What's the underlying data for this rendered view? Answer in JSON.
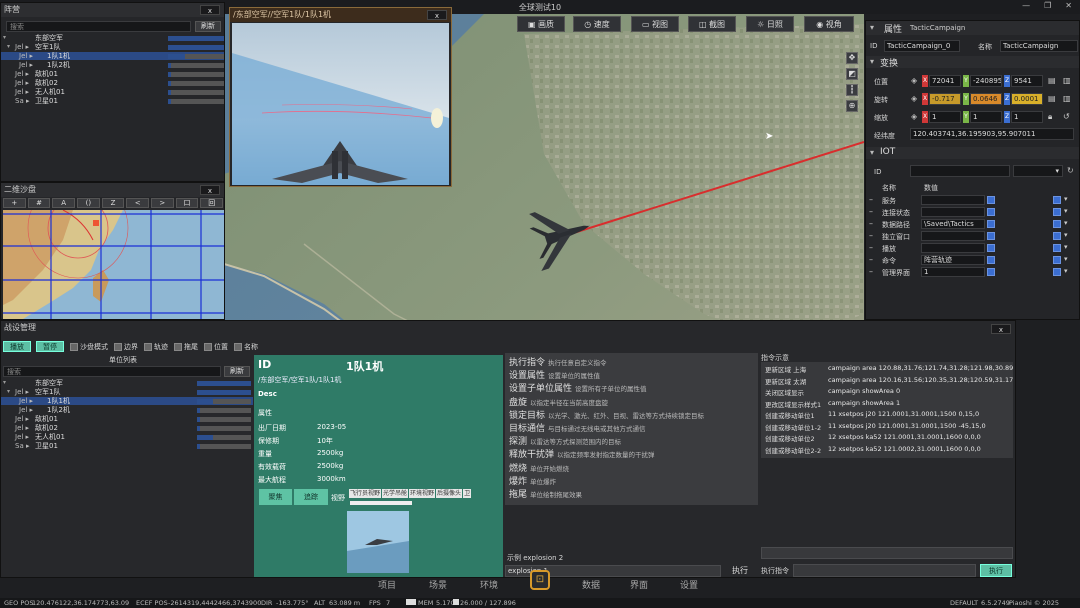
{
  "window": {
    "title": "全球测试10",
    "controls": [
      "—",
      "❐",
      "✕"
    ]
  },
  "toolbar": {
    "buttons": [
      "画质",
      "速度",
      "视图",
      "截图",
      "日照",
      "视角"
    ]
  },
  "formation": {
    "title": "阵营",
    "close": "x",
    "search_placeholder": "搜索",
    "refresh": "刷新",
    "rows": [
      {
        "prefix": "",
        "label": "东部空军",
        "level": 0
      },
      {
        "prefix": "Jel ▸",
        "label": "空军1队",
        "level": 1
      },
      {
        "prefix": "Jel ▸",
        "label": "1队1机",
        "level": 2,
        "selected": true
      },
      {
        "prefix": "Jel ▸",
        "label": "1队2机",
        "level": 2
      },
      {
        "prefix": "Jel ▸",
        "label": "敌机01",
        "level": 1
      },
      {
        "prefix": "Jel ▸",
        "label": "敌机02",
        "level": 1
      },
      {
        "prefix": "Jel ▸",
        "label": "无人机01",
        "level": 1
      },
      {
        "prefix": "Sa ▸",
        "label": "卫星01",
        "level": 1
      }
    ],
    "bar_levels": [
      1,
      1,
      0.3,
      0.05,
      0.05,
      0.05,
      0.05,
      0.05
    ]
  },
  "sandbox": {
    "title": "二维沙盘",
    "close": "x",
    "tools": [
      "+",
      "#",
      "A",
      "()",
      "Z",
      "<",
      ">",
      "口",
      "回"
    ]
  },
  "camera_view": {
    "title": "/东部空军//空军1队/1队1机",
    "close": "x"
  },
  "properties": {
    "title": "属性",
    "object_name": "TacticCampaign",
    "id_label": "ID",
    "id_value": "TacticCampaign_0",
    "name_label": "名称",
    "name_value": "TacticCampaign",
    "transform_header": "变换",
    "position_label": "位置",
    "position": [
      "72041",
      "-240895",
      "9541"
    ],
    "rotation_label": "旋转",
    "rotation": [
      "-0.717",
      "0.0646",
      "0.0001"
    ],
    "scale_label": "缩放",
    "scale": [
      "1",
      "1",
      "1"
    ],
    "lonlat_label": "经纬度",
    "lonlat_value": "120.403741,36.195903,95.907011",
    "iot_header": "IOT",
    "iot_id_label": "ID",
    "iot_col_name": "名称",
    "iot_col_value": "数值",
    "iot_rows": [
      {
        "name": "服务",
        "value": ""
      },
      {
        "name": "连接状态",
        "value": ""
      },
      {
        "name": "数据路径",
        "value": "\\Saved\\Tactics"
      },
      {
        "name": "独立窗口",
        "value": ""
      },
      {
        "name": "播放",
        "value": ""
      },
      {
        "name": "命令",
        "value": "阵营轨迹"
      },
      {
        "name": "管理界面",
        "value": "1"
      }
    ]
  },
  "campaign": {
    "title": "战设管理",
    "close": "x",
    "play": "播放",
    "pause": "暂停",
    "options": [
      "沙盘模式",
      "边界",
      "轨迹",
      "拖尾",
      "位置",
      "名称"
    ],
    "unit_list_title": "单位列表",
    "search_placeholder": "搜索",
    "refresh": "刷新",
    "rows": [
      {
        "prefix": "",
        "label": "东部空军",
        "level": 0
      },
      {
        "prefix": "Jel ▸",
        "label": "空军1队",
        "level": 1
      },
      {
        "prefix": "Jel ▸",
        "label": "1队1机",
        "level": 2,
        "selected": true
      },
      {
        "prefix": "Jel ▸",
        "label": "1队2机",
        "level": 2
      },
      {
        "prefix": "Jel ▸",
        "label": "敌机01",
        "level": 1
      },
      {
        "prefix": "Jel ▸",
        "label": "敌机02",
        "level": 1
      },
      {
        "prefix": "Jel ▸",
        "label": "无人机01",
        "level": 1
      },
      {
        "prefix": "Sa ▸",
        "label": "卫星01",
        "level": 1
      }
    ],
    "bar_levels": [
      1,
      1,
      0.3,
      0.05,
      0.05,
      0.05,
      0.3,
      0.05
    ]
  },
  "unit_detail": {
    "id_label": "ID",
    "id_value": "1队1机",
    "path": "/东部空军/空军1队/1队1机",
    "desc_label": "Desc",
    "attr_label": "属性",
    "fields": [
      {
        "k": "出厂日期",
        "v": "2023-05"
      },
      {
        "k": "保修期",
        "v": "10年"
      },
      {
        "k": "重量",
        "v": "2500kg"
      },
      {
        "k": "有效载荷",
        "v": "2500kg"
      },
      {
        "k": "最大航程",
        "v": "3000km"
      }
    ],
    "follow_btn": "聚焦",
    "track_btn": "追踪",
    "view_label": "视野",
    "view_tabs": [
      "飞行员视野",
      "光学吊舱",
      "环境视野",
      "后摄像头",
      "卫"
    ]
  },
  "commands": {
    "rows": [
      {
        "name": "执行指令",
        "desc": "执行任意自定义指令"
      },
      {
        "name": "设置属性",
        "desc": "设置单位的属性值"
      },
      {
        "name": "设置子单位属性",
        "desc": "设置所有子单位的属性值"
      },
      {
        "name": "盘旋",
        "desc": "以指定半径在当前高度盘旋"
      },
      {
        "name": "锁定目标",
        "desc": "以光学、激光、红外、目视、雷达等方式持续锁定目标"
      },
      {
        "name": "目标通信",
        "desc": "与目标通过无线电或其他方式通信"
      },
      {
        "name": "探测",
        "desc": "以雷达等方式探测范围内的目标"
      },
      {
        "name": "释放干扰弹",
        "desc": "以指定频率发射指定数量的干扰弹"
      },
      {
        "name": "燃烧",
        "desc": "单位开始燃烧"
      },
      {
        "name": "爆炸",
        "desc": "单位爆炸"
      },
      {
        "name": "拖尾",
        "desc": "单位绘制拖尾效果"
      }
    ],
    "example_label": "示例 explosion 2",
    "input_value": "explosion 1",
    "exec_btn": "执行"
  },
  "instructions": {
    "title": "指令示意",
    "rows": [
      {
        "k": "更新区域 上海",
        "v": "campaign area 120.88,31.76;121.74,31.28;121.98,30.89;12"
      },
      {
        "k": "更新区域 太湖",
        "v": "campaign area 120.16,31.56;120.35,31.28;120.59,31.17;12"
      },
      {
        "k": "关闭区域显示",
        "v": "campaign showArea 0"
      },
      {
        "k": "更改区域显示样式1",
        "v": "campaign showArea 1"
      },
      {
        "k": "创建或移动单位1",
        "v": "11 xsetpos j20 121.0001,31.0001,1500 0,15,0"
      },
      {
        "k": "创建或移动单位1-2",
        "v": "11 xsetpos j20 121.0001,31.0001,1500 -45,15,0"
      },
      {
        "k": "创建或移动单位2",
        "v": "12 xsetpos ka52 121.0001,31.0001,1600 0,0,0"
      },
      {
        "k": "创建或移动单位2-2",
        "v": "12 xsetpos ka52 121.0002,31.0001,1600 0,0,0"
      }
    ],
    "exec_label": "执行指令",
    "exec_btn": "执行"
  },
  "bottom_nav": {
    "items": [
      "项目",
      "场景",
      "环境",
      "数据",
      "界面",
      "设置"
    ]
  },
  "status": {
    "geo_label": "GEO POS",
    "geo": "120.476122,36.174773,63.09",
    "ecef_label": "ECEF POS",
    "ecef": "-2614319,4442466,3743900",
    "dir_label": "DIR",
    "dir": "-163.775°",
    "alt_label": "ALT",
    "alt": "63.089 m",
    "fps_label": "FPS",
    "fps": "7",
    "mem_label": "MEM",
    "mem": "5.17G",
    "zoom": "26.000 / 127.896",
    "profile": "DEFAULT",
    "version": "6.5.2749",
    "copyright": "Piaoshi © 2025"
  }
}
